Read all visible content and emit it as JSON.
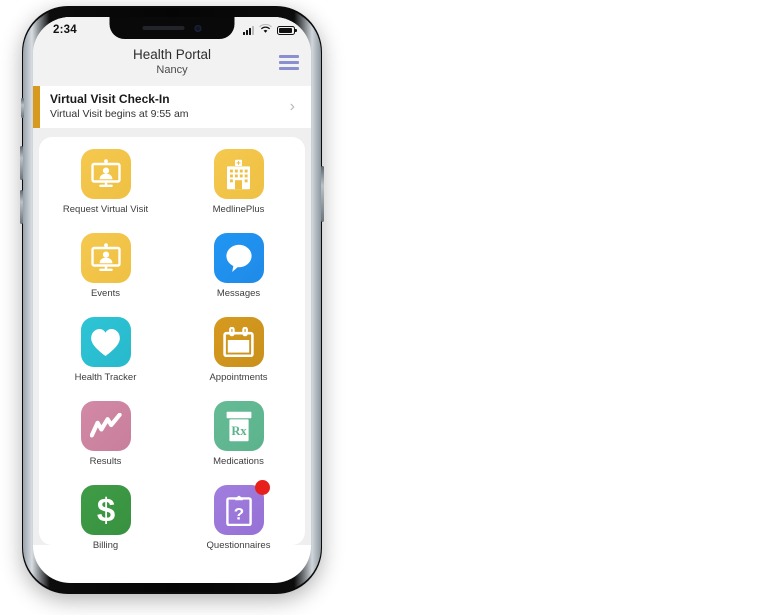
{
  "device": {
    "name": "smartphone-mockup",
    "status_bar": {
      "time": "2:34",
      "cellular_icon": "cellular-signal-icon",
      "wifi_icon": "wifi-icon",
      "battery_icon": "battery-icon"
    }
  },
  "header": {
    "title": "Health Portal",
    "subtitle": "Nancy",
    "menu_icon": "hamburger-menu-icon",
    "menu_color": "#8a8fd0"
  },
  "banner": {
    "title": "Virtual Visit Check-In",
    "subtitle": "Virtual Visit begins at 9:55 am",
    "chevron": "›",
    "accent_color": "#d79a1e"
  },
  "app_grid": [
    {
      "label": "Request Virtual Visit",
      "icon": "video-visit-icon",
      "color": "#f5c94f",
      "color2": "#eec043",
      "badge": null
    },
    {
      "label": "MedlinePlus",
      "icon": "hospital-building-icon",
      "color": "#f5c94f",
      "color2": "#eec043",
      "badge": null
    },
    {
      "label": "Events",
      "icon": "video-visit-icon",
      "color": "#f5c94f",
      "color2": "#eec043",
      "badge": null
    },
    {
      "label": "Messages",
      "icon": "speech-bubble-icon",
      "color": "#2196f3",
      "color2": "#1f8ae8",
      "badge": null
    },
    {
      "label": "Health Tracker",
      "icon": "heart-icon",
      "color": "#2ec4d6",
      "color2": "#27b9cc",
      "badge": null
    },
    {
      "label": "Appointments",
      "icon": "calendar-icon",
      "color": "#d79a1e",
      "color2": "#c9901c",
      "badge": null
    },
    {
      "label": "Results",
      "icon": "trend-line-icon",
      "color": "#d289a5",
      "color2": "#c87f9c",
      "badge": null
    },
    {
      "label": "Medications",
      "icon": "pill-bottle-rx-icon",
      "color": "#66bb96",
      "color2": "#5bb38c",
      "badge": null
    },
    {
      "label": "Billing",
      "icon": "dollar-sign-icon",
      "color": "#3f9c46",
      "color2": "#389140",
      "badge": null
    },
    {
      "label": "Questionnaires",
      "icon": "clipboard-question-icon",
      "color": "#a07ede",
      "color2": "#9671d6",
      "badge": "notification-badge"
    }
  ],
  "icon_glyphs": {
    "pill_bottle_text": "Rx",
    "dollar_text": "$",
    "question_text": "?"
  }
}
